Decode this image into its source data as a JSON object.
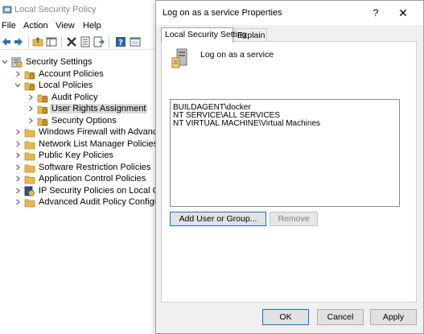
{
  "main_window": {
    "title": "Local Security Policy",
    "icon": "security-policy-app-icon"
  },
  "menu": {
    "items": [
      "File",
      "Action",
      "View",
      "Help"
    ]
  },
  "toolbar": {
    "buttons": [
      "back-arrow-icon",
      "forward-arrow-icon",
      "up-folder-icon",
      "show-hide-tree-icon",
      "delete-icon",
      "properties-icon",
      "export-list-icon",
      "help-icon",
      "mmc-view-icon"
    ]
  },
  "tree": {
    "items": [
      {
        "label": "Security Settings",
        "level": 0,
        "expanded": true,
        "icon": "security-settings-icon"
      },
      {
        "label": "Account Policies",
        "level": 1,
        "expanded": false,
        "icon": "folder-lock-icon"
      },
      {
        "label": "Local Policies",
        "level": 1,
        "expanded": true,
        "icon": "folder-lock-icon"
      },
      {
        "label": "Audit Policy",
        "level": 2,
        "expanded": false,
        "icon": "folder-lock-icon"
      },
      {
        "label": "User Rights Assignment",
        "level": 2,
        "expanded": false,
        "icon": "folder-lock-icon",
        "selected": true
      },
      {
        "label": "Security Options",
        "level": 2,
        "expanded": false,
        "icon": "folder-lock-icon"
      },
      {
        "label": "Windows Firewall with Advanced Secu",
        "level": 1,
        "expanded": false,
        "icon": "folder-icon"
      },
      {
        "label": "Network List Manager Policies",
        "level": 1,
        "expanded": false,
        "icon": "folder-icon"
      },
      {
        "label": "Public Key Policies",
        "level": 1,
        "expanded": false,
        "icon": "folder-icon"
      },
      {
        "label": "Software Restriction Policies",
        "level": 1,
        "expanded": false,
        "icon": "folder-icon"
      },
      {
        "label": "Application Control Policies",
        "level": 1,
        "expanded": false,
        "icon": "folder-icon"
      },
      {
        "label": "IP Security Policies on Local Compute",
        "level": 1,
        "expanded": false,
        "icon": "ip-security-icon"
      },
      {
        "label": "Advanced Audit Policy Configuration",
        "level": 1,
        "expanded": false,
        "icon": "folder-icon"
      }
    ]
  },
  "dialog": {
    "title": "Log on as a service Properties",
    "help_label": "?",
    "close_label": "✕",
    "tabs": [
      {
        "label": "Local Security Setting",
        "active": true
      },
      {
        "label": "Explain",
        "active": false
      }
    ],
    "policy_name": "Log on as a service",
    "members": [
      "BUILDAGENT\\docker",
      "NT SERVICE\\ALL SERVICES",
      "NT VIRTUAL MACHINE\\Virtual Machines"
    ],
    "add_label": "Add User or Group...",
    "remove_label": "Remove",
    "ok_label": "OK",
    "cancel_label": "Cancel",
    "apply_label": "Apply"
  },
  "colors": {
    "selection": "#d9d9d9",
    "folder": "#e8b84a",
    "accent_border": "#0078d7",
    "dialog_bg": "#f0f0f0"
  }
}
